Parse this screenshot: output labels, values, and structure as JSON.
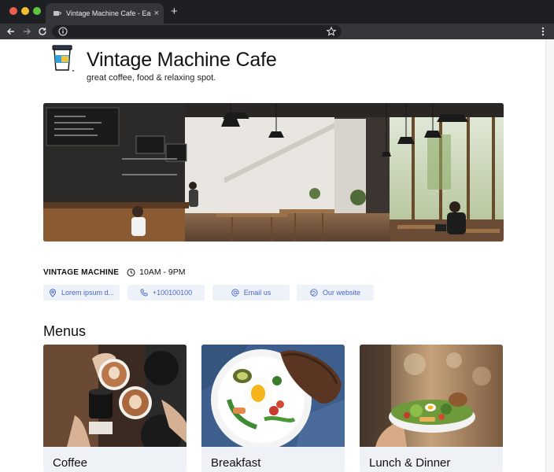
{
  "browser": {
    "tab_title": "Vintage Machine Cafe - EasyQR",
    "tab_close": "×",
    "new_tab": "+",
    "url": ""
  },
  "header": {
    "title": "Vintage Machine Cafe",
    "tagline": "great coffee, food & relaxing spot."
  },
  "info": {
    "brand": "VINTAGE MACHINE",
    "hours": "10AM - 9PM"
  },
  "chips": [
    {
      "label": "Lorem ipsum d...",
      "icon": "location-pin-icon"
    },
    {
      "label": "+100100100",
      "icon": "phone-icon"
    },
    {
      "label": "Email us",
      "icon": "at-sign-icon"
    },
    {
      "label": "Our website",
      "icon": "globe-icon"
    }
  ],
  "menus": {
    "heading": "Menus",
    "items": [
      {
        "label": "Coffee"
      },
      {
        "label": "Breakfast"
      },
      {
        "label": "Lunch & Dinner"
      }
    ]
  },
  "colors": {
    "accent": "#4667c4",
    "chip_bg": "#eef2f9",
    "card_bg": "#eef1f6",
    "chrome_dark": "#1e1f22"
  }
}
